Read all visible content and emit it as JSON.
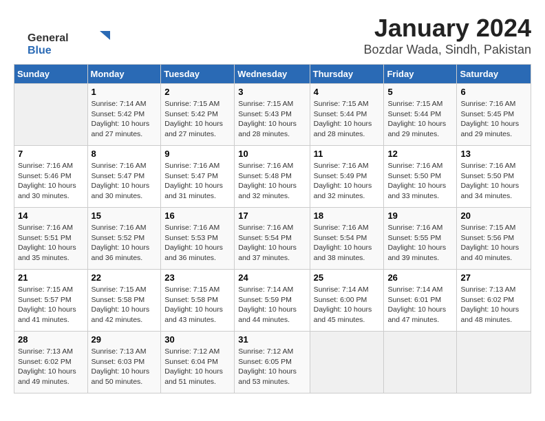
{
  "logo": {
    "general": "General",
    "blue": "Blue"
  },
  "header": {
    "month": "January 2024",
    "location": "Bozdar Wada, Sindh, Pakistan"
  },
  "weekdays": [
    "Sunday",
    "Monday",
    "Tuesday",
    "Wednesday",
    "Thursday",
    "Friday",
    "Saturday"
  ],
  "weeks": [
    [
      {
        "day": "",
        "sunrise": "",
        "sunset": "",
        "daylight": ""
      },
      {
        "day": "1",
        "sunrise": "Sunrise: 7:14 AM",
        "sunset": "Sunset: 5:42 PM",
        "daylight": "Daylight: 10 hours and 27 minutes."
      },
      {
        "day": "2",
        "sunrise": "Sunrise: 7:15 AM",
        "sunset": "Sunset: 5:42 PM",
        "daylight": "Daylight: 10 hours and 27 minutes."
      },
      {
        "day": "3",
        "sunrise": "Sunrise: 7:15 AM",
        "sunset": "Sunset: 5:43 PM",
        "daylight": "Daylight: 10 hours and 28 minutes."
      },
      {
        "day": "4",
        "sunrise": "Sunrise: 7:15 AM",
        "sunset": "Sunset: 5:44 PM",
        "daylight": "Daylight: 10 hours and 28 minutes."
      },
      {
        "day": "5",
        "sunrise": "Sunrise: 7:15 AM",
        "sunset": "Sunset: 5:44 PM",
        "daylight": "Daylight: 10 hours and 29 minutes."
      },
      {
        "day": "6",
        "sunrise": "Sunrise: 7:16 AM",
        "sunset": "Sunset: 5:45 PM",
        "daylight": "Daylight: 10 hours and 29 minutes."
      }
    ],
    [
      {
        "day": "7",
        "sunrise": "Sunrise: 7:16 AM",
        "sunset": "Sunset: 5:46 PM",
        "daylight": "Daylight: 10 hours and 30 minutes."
      },
      {
        "day": "8",
        "sunrise": "Sunrise: 7:16 AM",
        "sunset": "Sunset: 5:47 PM",
        "daylight": "Daylight: 10 hours and 30 minutes."
      },
      {
        "day": "9",
        "sunrise": "Sunrise: 7:16 AM",
        "sunset": "Sunset: 5:47 PM",
        "daylight": "Daylight: 10 hours and 31 minutes."
      },
      {
        "day": "10",
        "sunrise": "Sunrise: 7:16 AM",
        "sunset": "Sunset: 5:48 PM",
        "daylight": "Daylight: 10 hours and 32 minutes."
      },
      {
        "day": "11",
        "sunrise": "Sunrise: 7:16 AM",
        "sunset": "Sunset: 5:49 PM",
        "daylight": "Daylight: 10 hours and 32 minutes."
      },
      {
        "day": "12",
        "sunrise": "Sunrise: 7:16 AM",
        "sunset": "Sunset: 5:50 PM",
        "daylight": "Daylight: 10 hours and 33 minutes."
      },
      {
        "day": "13",
        "sunrise": "Sunrise: 7:16 AM",
        "sunset": "Sunset: 5:50 PM",
        "daylight": "Daylight: 10 hours and 34 minutes."
      }
    ],
    [
      {
        "day": "14",
        "sunrise": "Sunrise: 7:16 AM",
        "sunset": "Sunset: 5:51 PM",
        "daylight": "Daylight: 10 hours and 35 minutes."
      },
      {
        "day": "15",
        "sunrise": "Sunrise: 7:16 AM",
        "sunset": "Sunset: 5:52 PM",
        "daylight": "Daylight: 10 hours and 36 minutes."
      },
      {
        "day": "16",
        "sunrise": "Sunrise: 7:16 AM",
        "sunset": "Sunset: 5:53 PM",
        "daylight": "Daylight: 10 hours and 36 minutes."
      },
      {
        "day": "17",
        "sunrise": "Sunrise: 7:16 AM",
        "sunset": "Sunset: 5:54 PM",
        "daylight": "Daylight: 10 hours and 37 minutes."
      },
      {
        "day": "18",
        "sunrise": "Sunrise: 7:16 AM",
        "sunset": "Sunset: 5:54 PM",
        "daylight": "Daylight: 10 hours and 38 minutes."
      },
      {
        "day": "19",
        "sunrise": "Sunrise: 7:16 AM",
        "sunset": "Sunset: 5:55 PM",
        "daylight": "Daylight: 10 hours and 39 minutes."
      },
      {
        "day": "20",
        "sunrise": "Sunrise: 7:15 AM",
        "sunset": "Sunset: 5:56 PM",
        "daylight": "Daylight: 10 hours and 40 minutes."
      }
    ],
    [
      {
        "day": "21",
        "sunrise": "Sunrise: 7:15 AM",
        "sunset": "Sunset: 5:57 PM",
        "daylight": "Daylight: 10 hours and 41 minutes."
      },
      {
        "day": "22",
        "sunrise": "Sunrise: 7:15 AM",
        "sunset": "Sunset: 5:58 PM",
        "daylight": "Daylight: 10 hours and 42 minutes."
      },
      {
        "day": "23",
        "sunrise": "Sunrise: 7:15 AM",
        "sunset": "Sunset: 5:58 PM",
        "daylight": "Daylight: 10 hours and 43 minutes."
      },
      {
        "day": "24",
        "sunrise": "Sunrise: 7:14 AM",
        "sunset": "Sunset: 5:59 PM",
        "daylight": "Daylight: 10 hours and 44 minutes."
      },
      {
        "day": "25",
        "sunrise": "Sunrise: 7:14 AM",
        "sunset": "Sunset: 6:00 PM",
        "daylight": "Daylight: 10 hours and 45 minutes."
      },
      {
        "day": "26",
        "sunrise": "Sunrise: 7:14 AM",
        "sunset": "Sunset: 6:01 PM",
        "daylight": "Daylight: 10 hours and 47 minutes."
      },
      {
        "day": "27",
        "sunrise": "Sunrise: 7:13 AM",
        "sunset": "Sunset: 6:02 PM",
        "daylight": "Daylight: 10 hours and 48 minutes."
      }
    ],
    [
      {
        "day": "28",
        "sunrise": "Sunrise: 7:13 AM",
        "sunset": "Sunset: 6:02 PM",
        "daylight": "Daylight: 10 hours and 49 minutes."
      },
      {
        "day": "29",
        "sunrise": "Sunrise: 7:13 AM",
        "sunset": "Sunset: 6:03 PM",
        "daylight": "Daylight: 10 hours and 50 minutes."
      },
      {
        "day": "30",
        "sunrise": "Sunrise: 7:12 AM",
        "sunset": "Sunset: 6:04 PM",
        "daylight": "Daylight: 10 hours and 51 minutes."
      },
      {
        "day": "31",
        "sunrise": "Sunrise: 7:12 AM",
        "sunset": "Sunset: 6:05 PM",
        "daylight": "Daylight: 10 hours and 53 minutes."
      },
      {
        "day": "",
        "sunrise": "",
        "sunset": "",
        "daylight": ""
      },
      {
        "day": "",
        "sunrise": "",
        "sunset": "",
        "daylight": ""
      },
      {
        "day": "",
        "sunrise": "",
        "sunset": "",
        "daylight": ""
      }
    ]
  ]
}
